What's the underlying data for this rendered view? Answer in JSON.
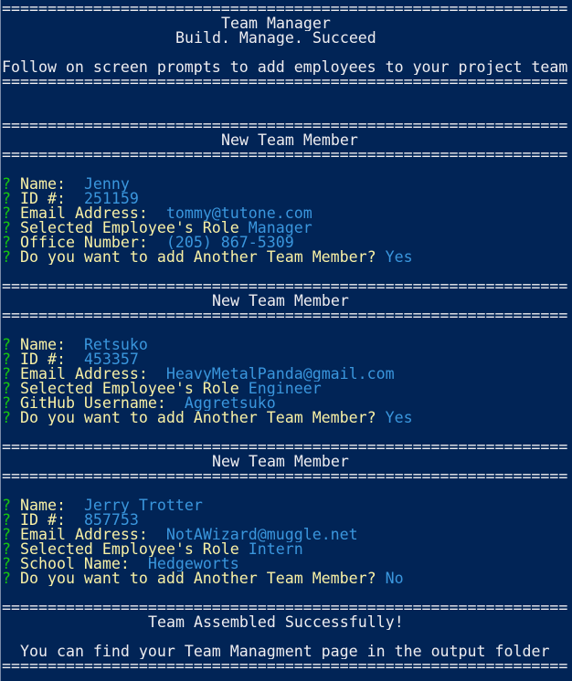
{
  "separator": "==============================================================",
  "banner": {
    "title": "Team Manager",
    "tagline": "Build. Manage. Succeed",
    "instructions": "Follow on screen prompts to add employees to your project team"
  },
  "prompt_symbol": "?",
  "members": [
    {
      "header": "New Team Member",
      "name_label": "Name:",
      "name": "Jenny",
      "id_label": "ID #:",
      "id": "251159",
      "email_label": "Email Address:",
      "email": "tommy@tutone.com",
      "role_label": "Selected Employee's Role",
      "role": "Manager",
      "extra_label": "Office Number:",
      "extra": "(205) 867-5309",
      "another_label": "Do you want to add Another Team Member?",
      "another": "Yes"
    },
    {
      "header": "New Team Member",
      "name_label": "Name:",
      "name": "Retsuko",
      "id_label": "ID #:",
      "id": "453357",
      "email_label": "Email Address:",
      "email": "HeavyMetalPanda@gmail.com",
      "role_label": "Selected Employee's Role",
      "role": "Engineer",
      "extra_label": "GitHub Username:",
      "extra": "Aggretsuko",
      "another_label": "Do you want to add Another Team Member?",
      "another": "Yes"
    },
    {
      "header": "New Team Member",
      "name_label": "Name:",
      "name": "Jerry Trotter",
      "id_label": "ID #:",
      "id": "857753",
      "email_label": "Email Address:",
      "email": "NotAWizard@muggle.net",
      "role_label": "Selected Employee's Role",
      "role": "Intern",
      "extra_label": "School Name:",
      "extra": "Hedgeworts",
      "another_label": "Do you want to add Another Team Member?",
      "another": "No"
    }
  ],
  "footer": {
    "title": "Team Assembled Successfully!",
    "message": "You can find your Team Managment page in the output folder"
  },
  "colors": {
    "background": "#012456",
    "text": "#eeedf0",
    "prompt_mark": "#16c60c",
    "question": "#f9f1a5",
    "answer": "#3a96dd"
  }
}
